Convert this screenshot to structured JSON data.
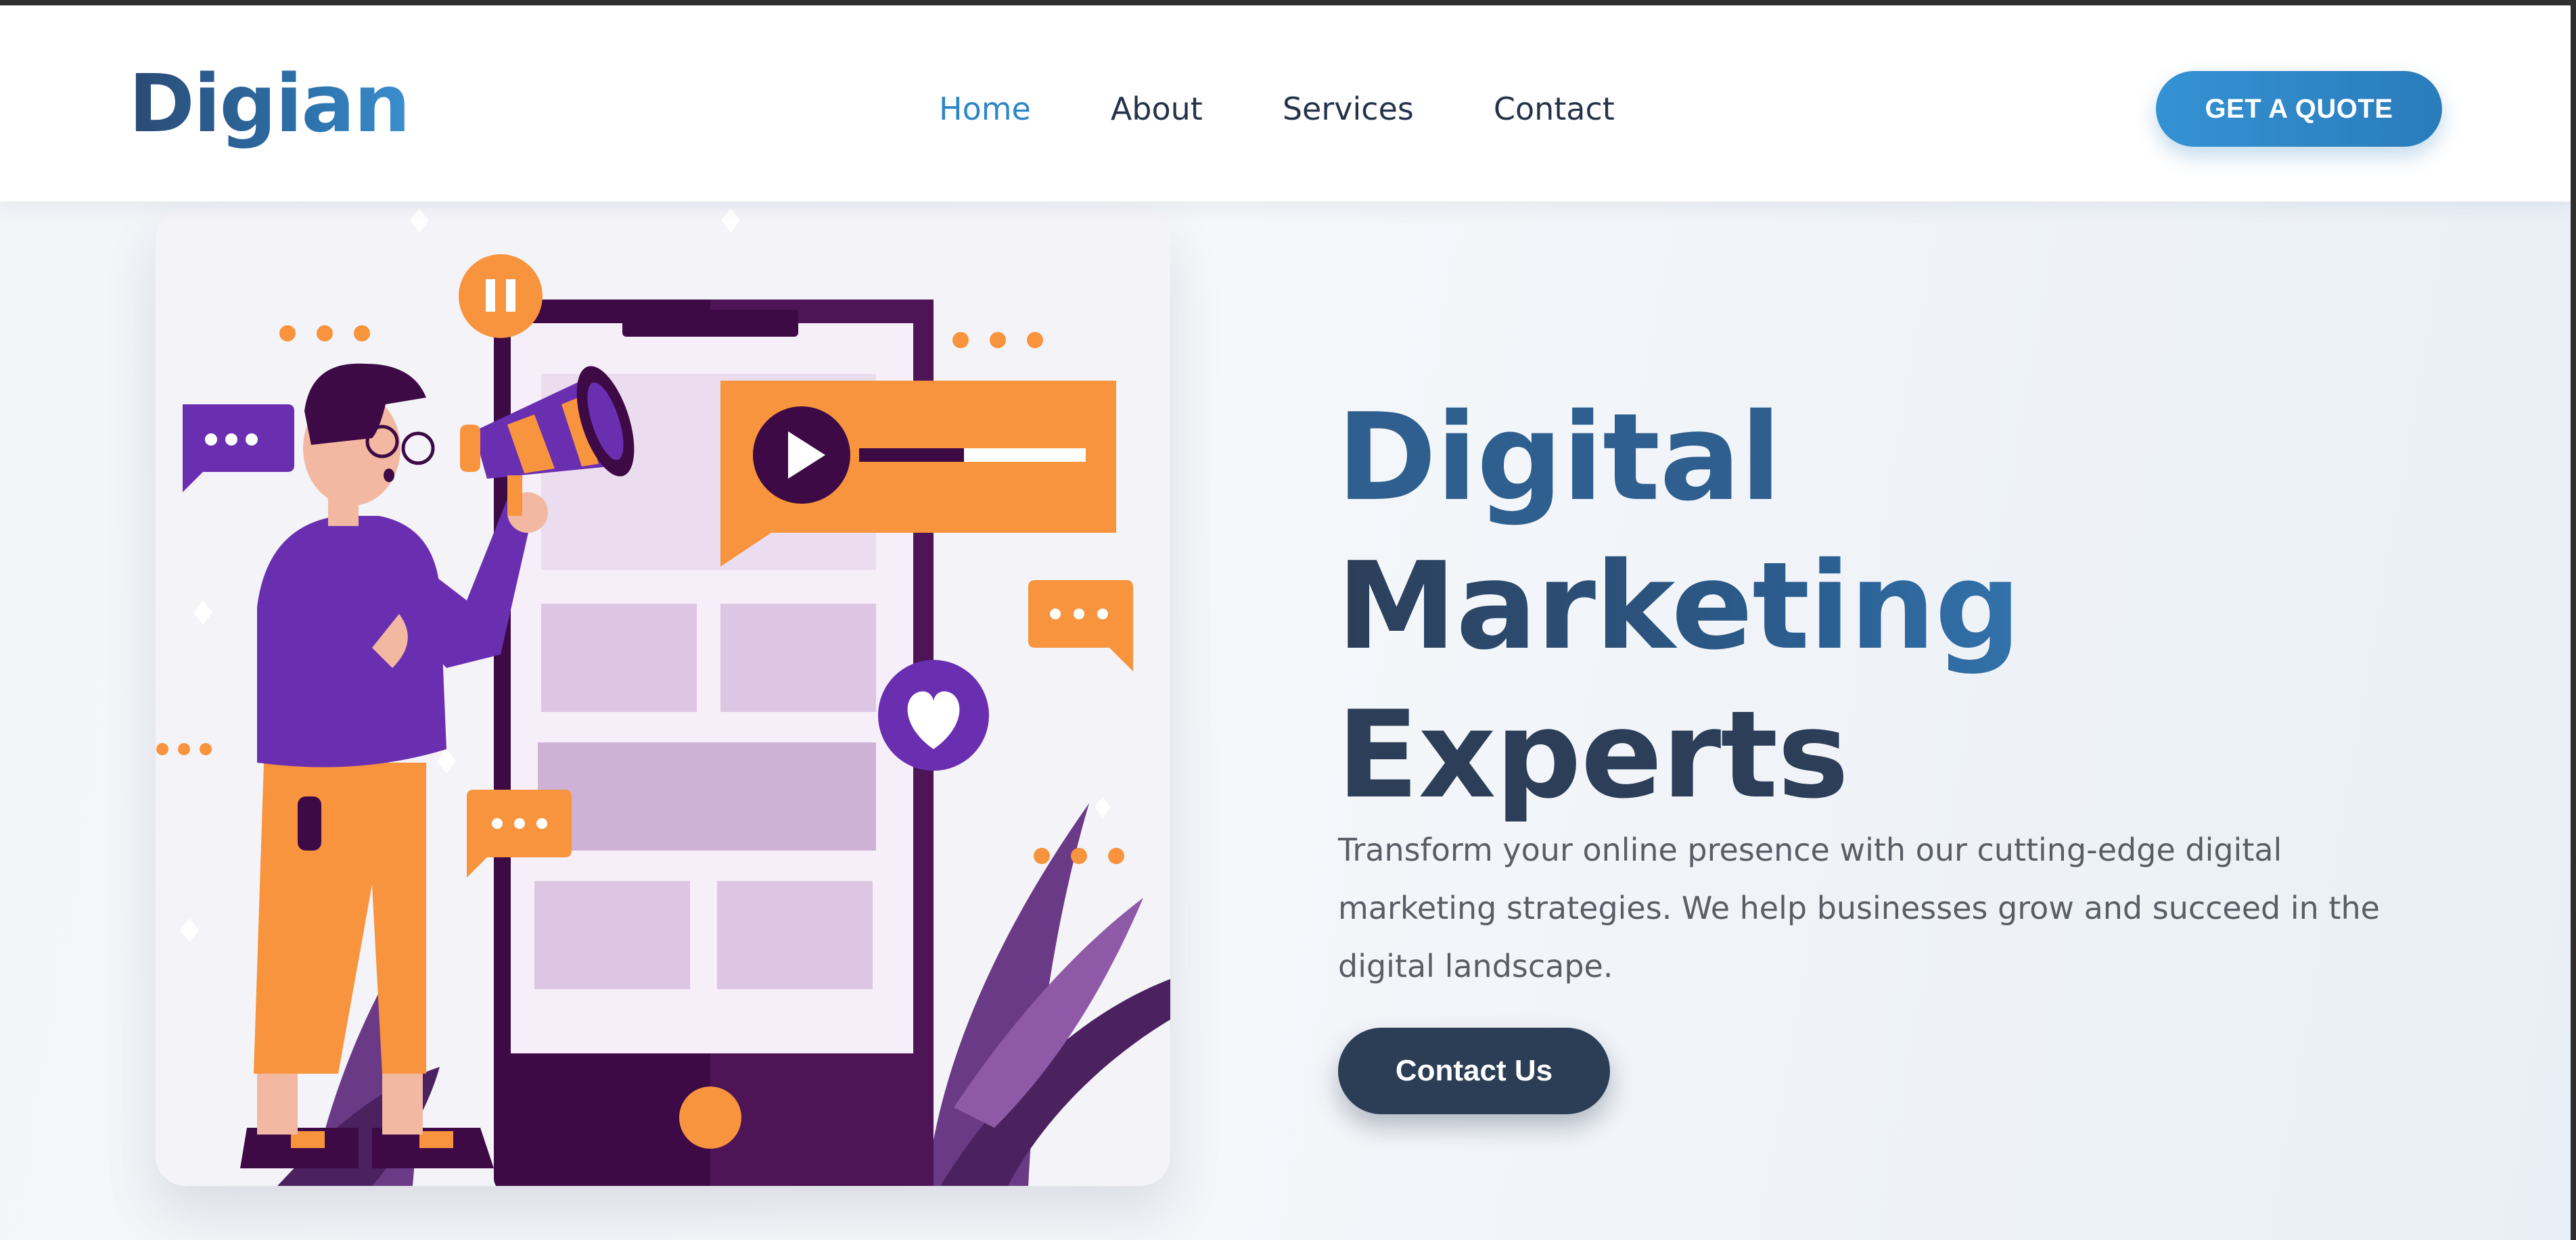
{
  "nav": {
    "logo": "Digian",
    "links": [
      {
        "label": "Home",
        "active": true
      },
      {
        "label": "About",
        "active": false
      },
      {
        "label": "Services",
        "active": false
      },
      {
        "label": "Contact",
        "active": false
      }
    ],
    "cta_label": "GET A QUOTE"
  },
  "hero": {
    "headline_lines": [
      "Digital",
      "Marketing",
      "Experts"
    ],
    "description": "Transform your online presence with our cutting-edge digital marketing strategies. We help businesses grow and succeed in the digital landscape.",
    "cta_label": "Contact Us"
  },
  "colors": {
    "accent_blue": "#2d86c6",
    "dark_navy": "#2b3e56",
    "illustration_purple": "#6a2fb0",
    "illustration_orange": "#f7943d"
  },
  "illustration": {
    "icons": [
      "megaphone-icon",
      "play-icon",
      "pause-icon",
      "heart-icon",
      "chat-bubble-icon"
    ]
  }
}
